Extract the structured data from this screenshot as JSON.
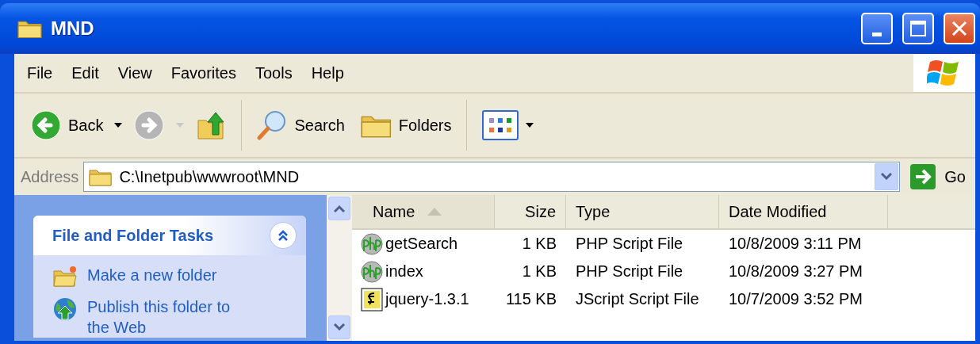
{
  "window": {
    "title": "MND"
  },
  "menu": [
    "File",
    "Edit",
    "View",
    "Favorites",
    "Tools",
    "Help"
  ],
  "toolbar": {
    "back": {
      "label": "Back",
      "disabled": false
    },
    "forward": {
      "disabled": true
    },
    "search_label": "Search",
    "folders_label": "Folders"
  },
  "address": {
    "label": "Address",
    "value": "C:\\Inetpub\\wwwroot\\MND",
    "go_label": "Go"
  },
  "task_pane": {
    "title": "File and Folder Tasks",
    "expanded": true,
    "tasks": [
      {
        "kind": "new_folder",
        "label": "Make a new folder"
      },
      {
        "kind": "publish",
        "label": "Publish this folder to the Web"
      }
    ]
  },
  "file_list": {
    "columns": [
      {
        "label": "Name",
        "sorted": true
      },
      {
        "label": "Size",
        "sorted": false
      },
      {
        "label": "Type",
        "sorted": false
      },
      {
        "label": "Date Modified",
        "sorted": false
      }
    ],
    "files": [
      {
        "kind": "php",
        "name": "getSearch",
        "size": "1 KB",
        "type": "PHP Script File",
        "date": "10/8/2009 3:11 PM"
      },
      {
        "kind": "php",
        "name": "index",
        "size": "1 KB",
        "type": "PHP Script File",
        "date": "10/8/2009 3:27 PM"
      },
      {
        "kind": "script",
        "name": "jquery-1.3.1",
        "size": "115 KB",
        "type": "JScript Script File",
        "date": "10/7/2009 3:52 PM"
      }
    ]
  }
}
